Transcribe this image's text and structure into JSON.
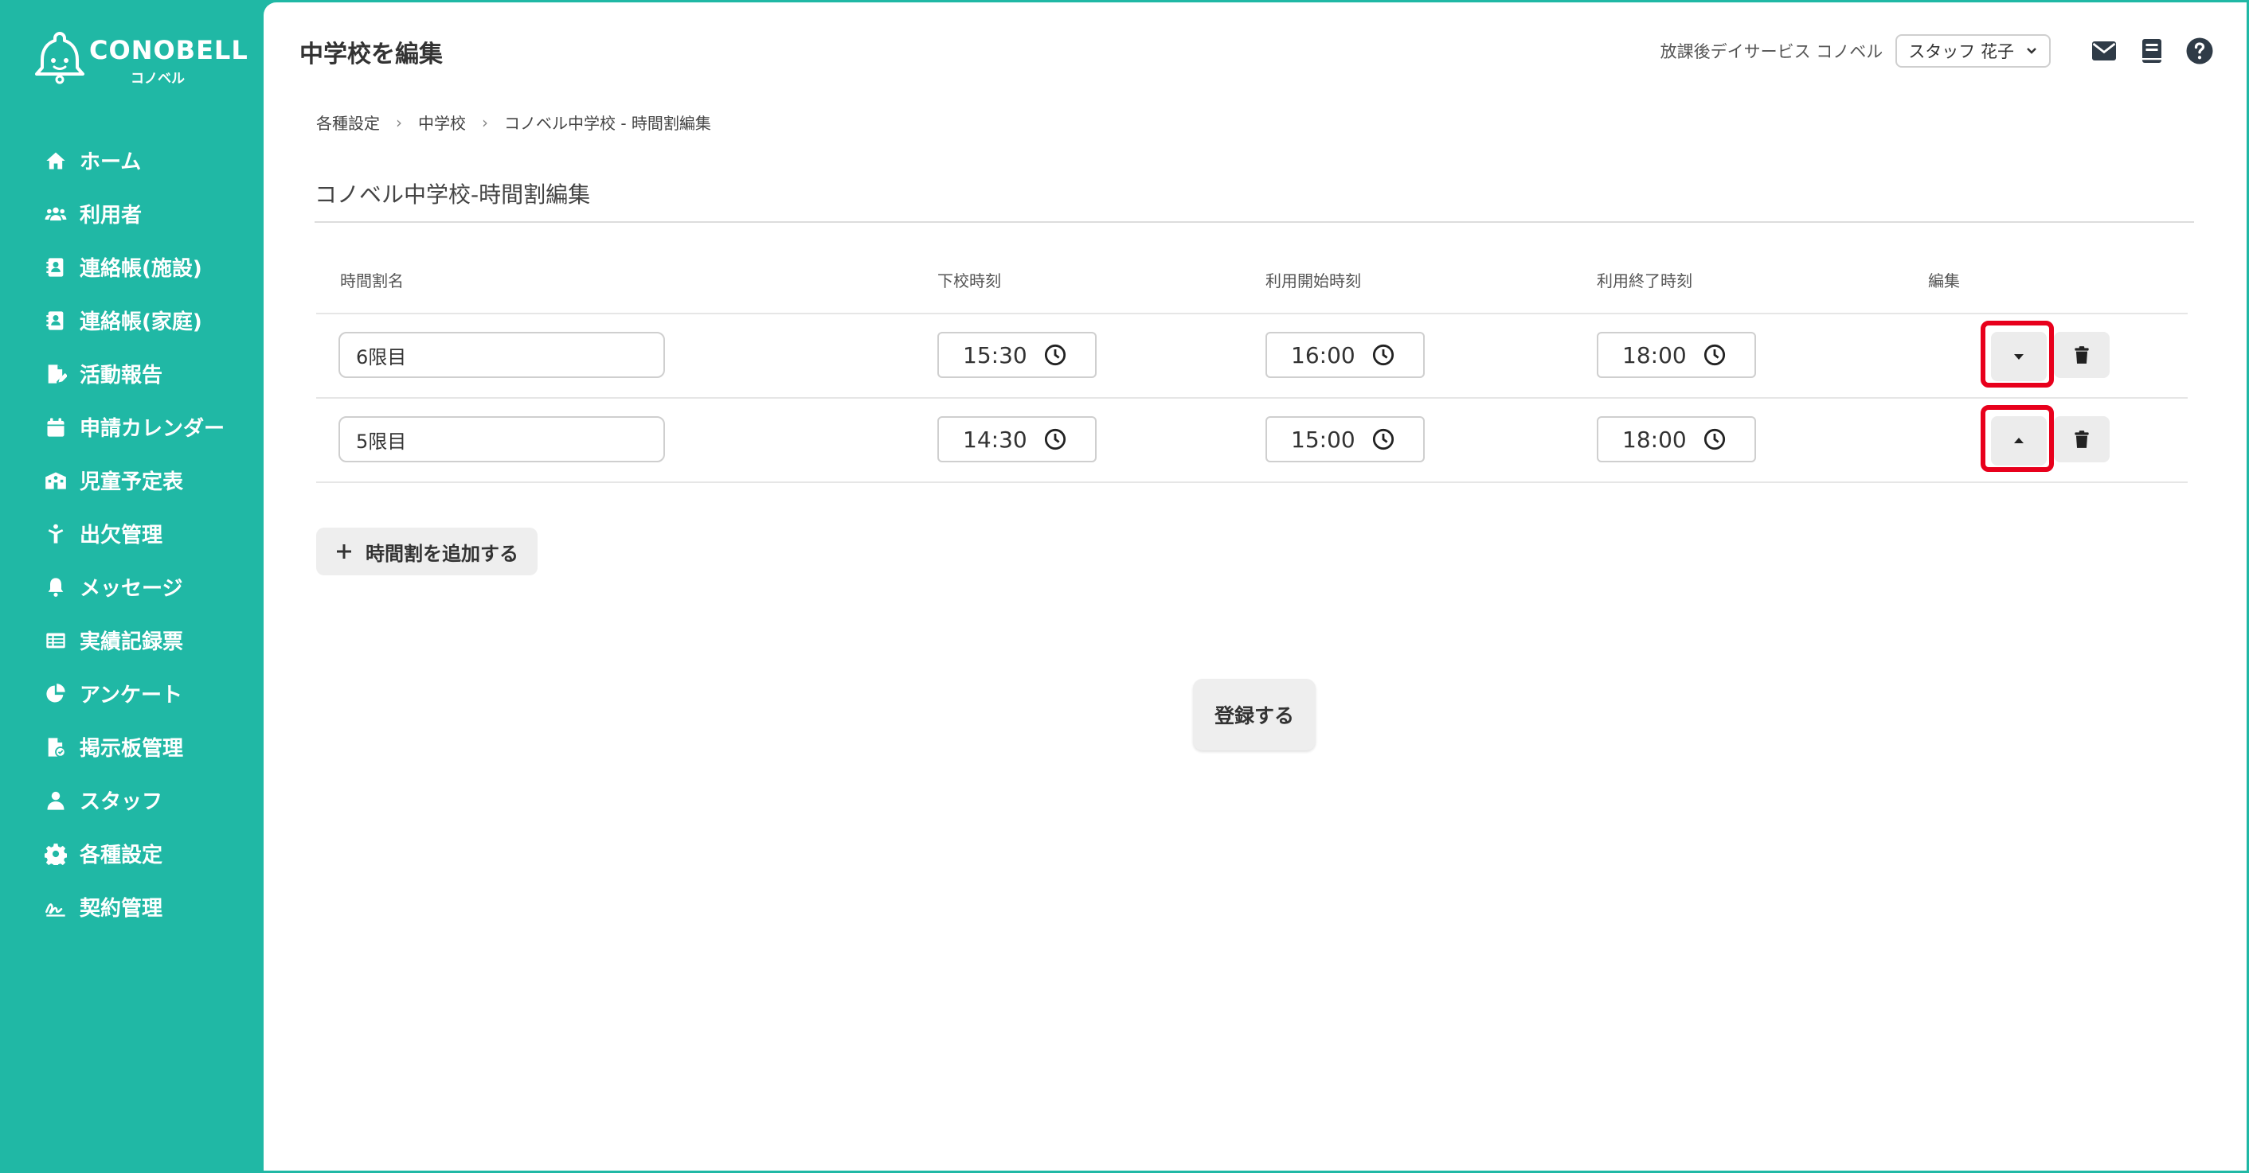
{
  "brand": {
    "name": "CONOBELL",
    "sub": "コノベル"
  },
  "sidebar": {
    "items": [
      {
        "label": "ホーム",
        "icon": "home-icon"
      },
      {
        "label": "利用者",
        "icon": "users-icon"
      },
      {
        "label": "連絡帳(施設)",
        "icon": "contact-book-icon"
      },
      {
        "label": "連絡帳(家庭)",
        "icon": "contact-book-icon"
      },
      {
        "label": "活動報告",
        "icon": "report-icon"
      },
      {
        "label": "申請カレンダー",
        "icon": "calendar-icon"
      },
      {
        "label": "児童予定表",
        "icon": "schedule-icon"
      },
      {
        "label": "出欠管理",
        "icon": "attendance-icon"
      },
      {
        "label": "メッセージ",
        "icon": "bell-icon"
      },
      {
        "label": "実績記録票",
        "icon": "table-icon"
      },
      {
        "label": "アンケート",
        "icon": "pie-chart-icon"
      },
      {
        "label": "掲示板管理",
        "icon": "board-icon"
      },
      {
        "label": "スタッフ",
        "icon": "staff-icon"
      },
      {
        "label": "各種設定",
        "icon": "gear-icon"
      },
      {
        "label": "契約管理",
        "icon": "contract-icon"
      }
    ]
  },
  "header": {
    "title": "中学校を編集",
    "facility": "放課後デイサービス コノベル",
    "staff": "スタッフ 花子"
  },
  "breadcrumb": [
    "各種設定",
    "中学校",
    "コノベル中学校 - 時間割編集"
  ],
  "section_title": "コノベル中学校-時間割編集",
  "table": {
    "headers": {
      "name": "時間割名",
      "dismissal": "下校時刻",
      "start": "利用開始時刻",
      "end": "利用終了時刻",
      "edit": "編集"
    },
    "rows": [
      {
        "name": "6限目",
        "dismissal": "15:30",
        "start": "16:00",
        "end": "18:00",
        "order": "down"
      },
      {
        "name": "5限目",
        "dismissal": "14:30",
        "start": "15:00",
        "end": "18:00",
        "order": "up"
      }
    ]
  },
  "add_label": "時間割を追加する",
  "submit_label": "登録する",
  "colors": {
    "accent": "#20b8a5",
    "highlight": "#e8001c"
  }
}
